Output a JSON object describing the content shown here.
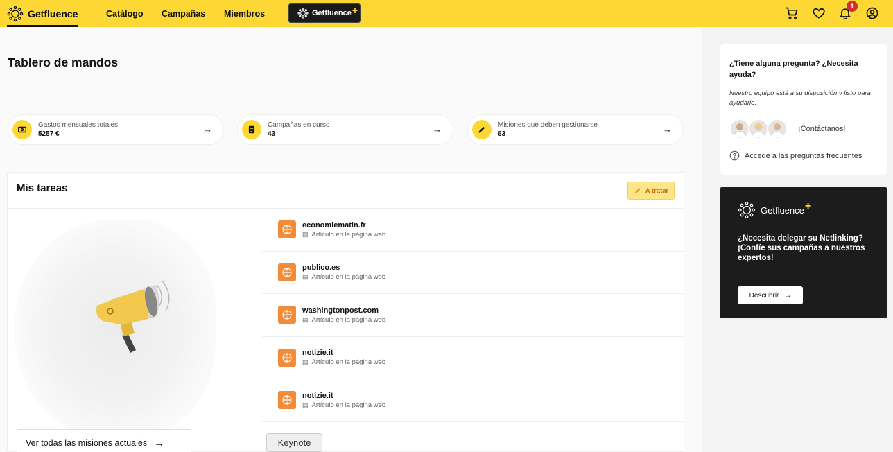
{
  "nav": {
    "brand": "Getfluence",
    "items": [
      "Catálogo",
      "Campañas",
      "Miembros"
    ],
    "plus_badge": "Getfluence",
    "notification_count": "1"
  },
  "page": {
    "title": "Tablero de mandos"
  },
  "stats": [
    {
      "label": "Gastos mensuales totales",
      "value": "5257 €",
      "icon": "money-icon"
    },
    {
      "label": "Campañas en curso",
      "value": "43",
      "icon": "document-icon"
    },
    {
      "label": "Misiones que deben gestionarse",
      "value": "63",
      "icon": "pencil-icon"
    }
  ],
  "tasks": {
    "title": "Mis tareas",
    "filter_label": "A tratar",
    "items": [
      {
        "name": "economiematin.fr",
        "type": "Artículo en la página web"
      },
      {
        "name": "publico.es",
        "type": "Artículo en la página web"
      },
      {
        "name": "washingtonpost.com",
        "type": "Artículo en la página web"
      },
      {
        "name": "notizie.it",
        "type": "Artículo en la página web"
      },
      {
        "name": "notizie.it",
        "type": "Artículo en la página web"
      }
    ],
    "see_all": "Ver todas las misiones actuales"
  },
  "tooltip": "Keynote",
  "help": {
    "title": "¿Tiene alguna pregunta? ¿Necesita ayuda?",
    "text": "Nuestro equipo está a su disposición y listo para ayudarle.",
    "contact_link": "¡Contáctanos!",
    "faq_link": "Accede a las preguntas frecuentes"
  },
  "promo": {
    "brand": "Getfluence",
    "text": "¿Necesita delegar su Netlinking? ¡Confíe sus campañas a nuestros expertos!",
    "button": "Descubrir"
  },
  "colors": {
    "accent": "#fdd835",
    "task_icon": "#f28c38",
    "dark": "#1c1c1c"
  }
}
